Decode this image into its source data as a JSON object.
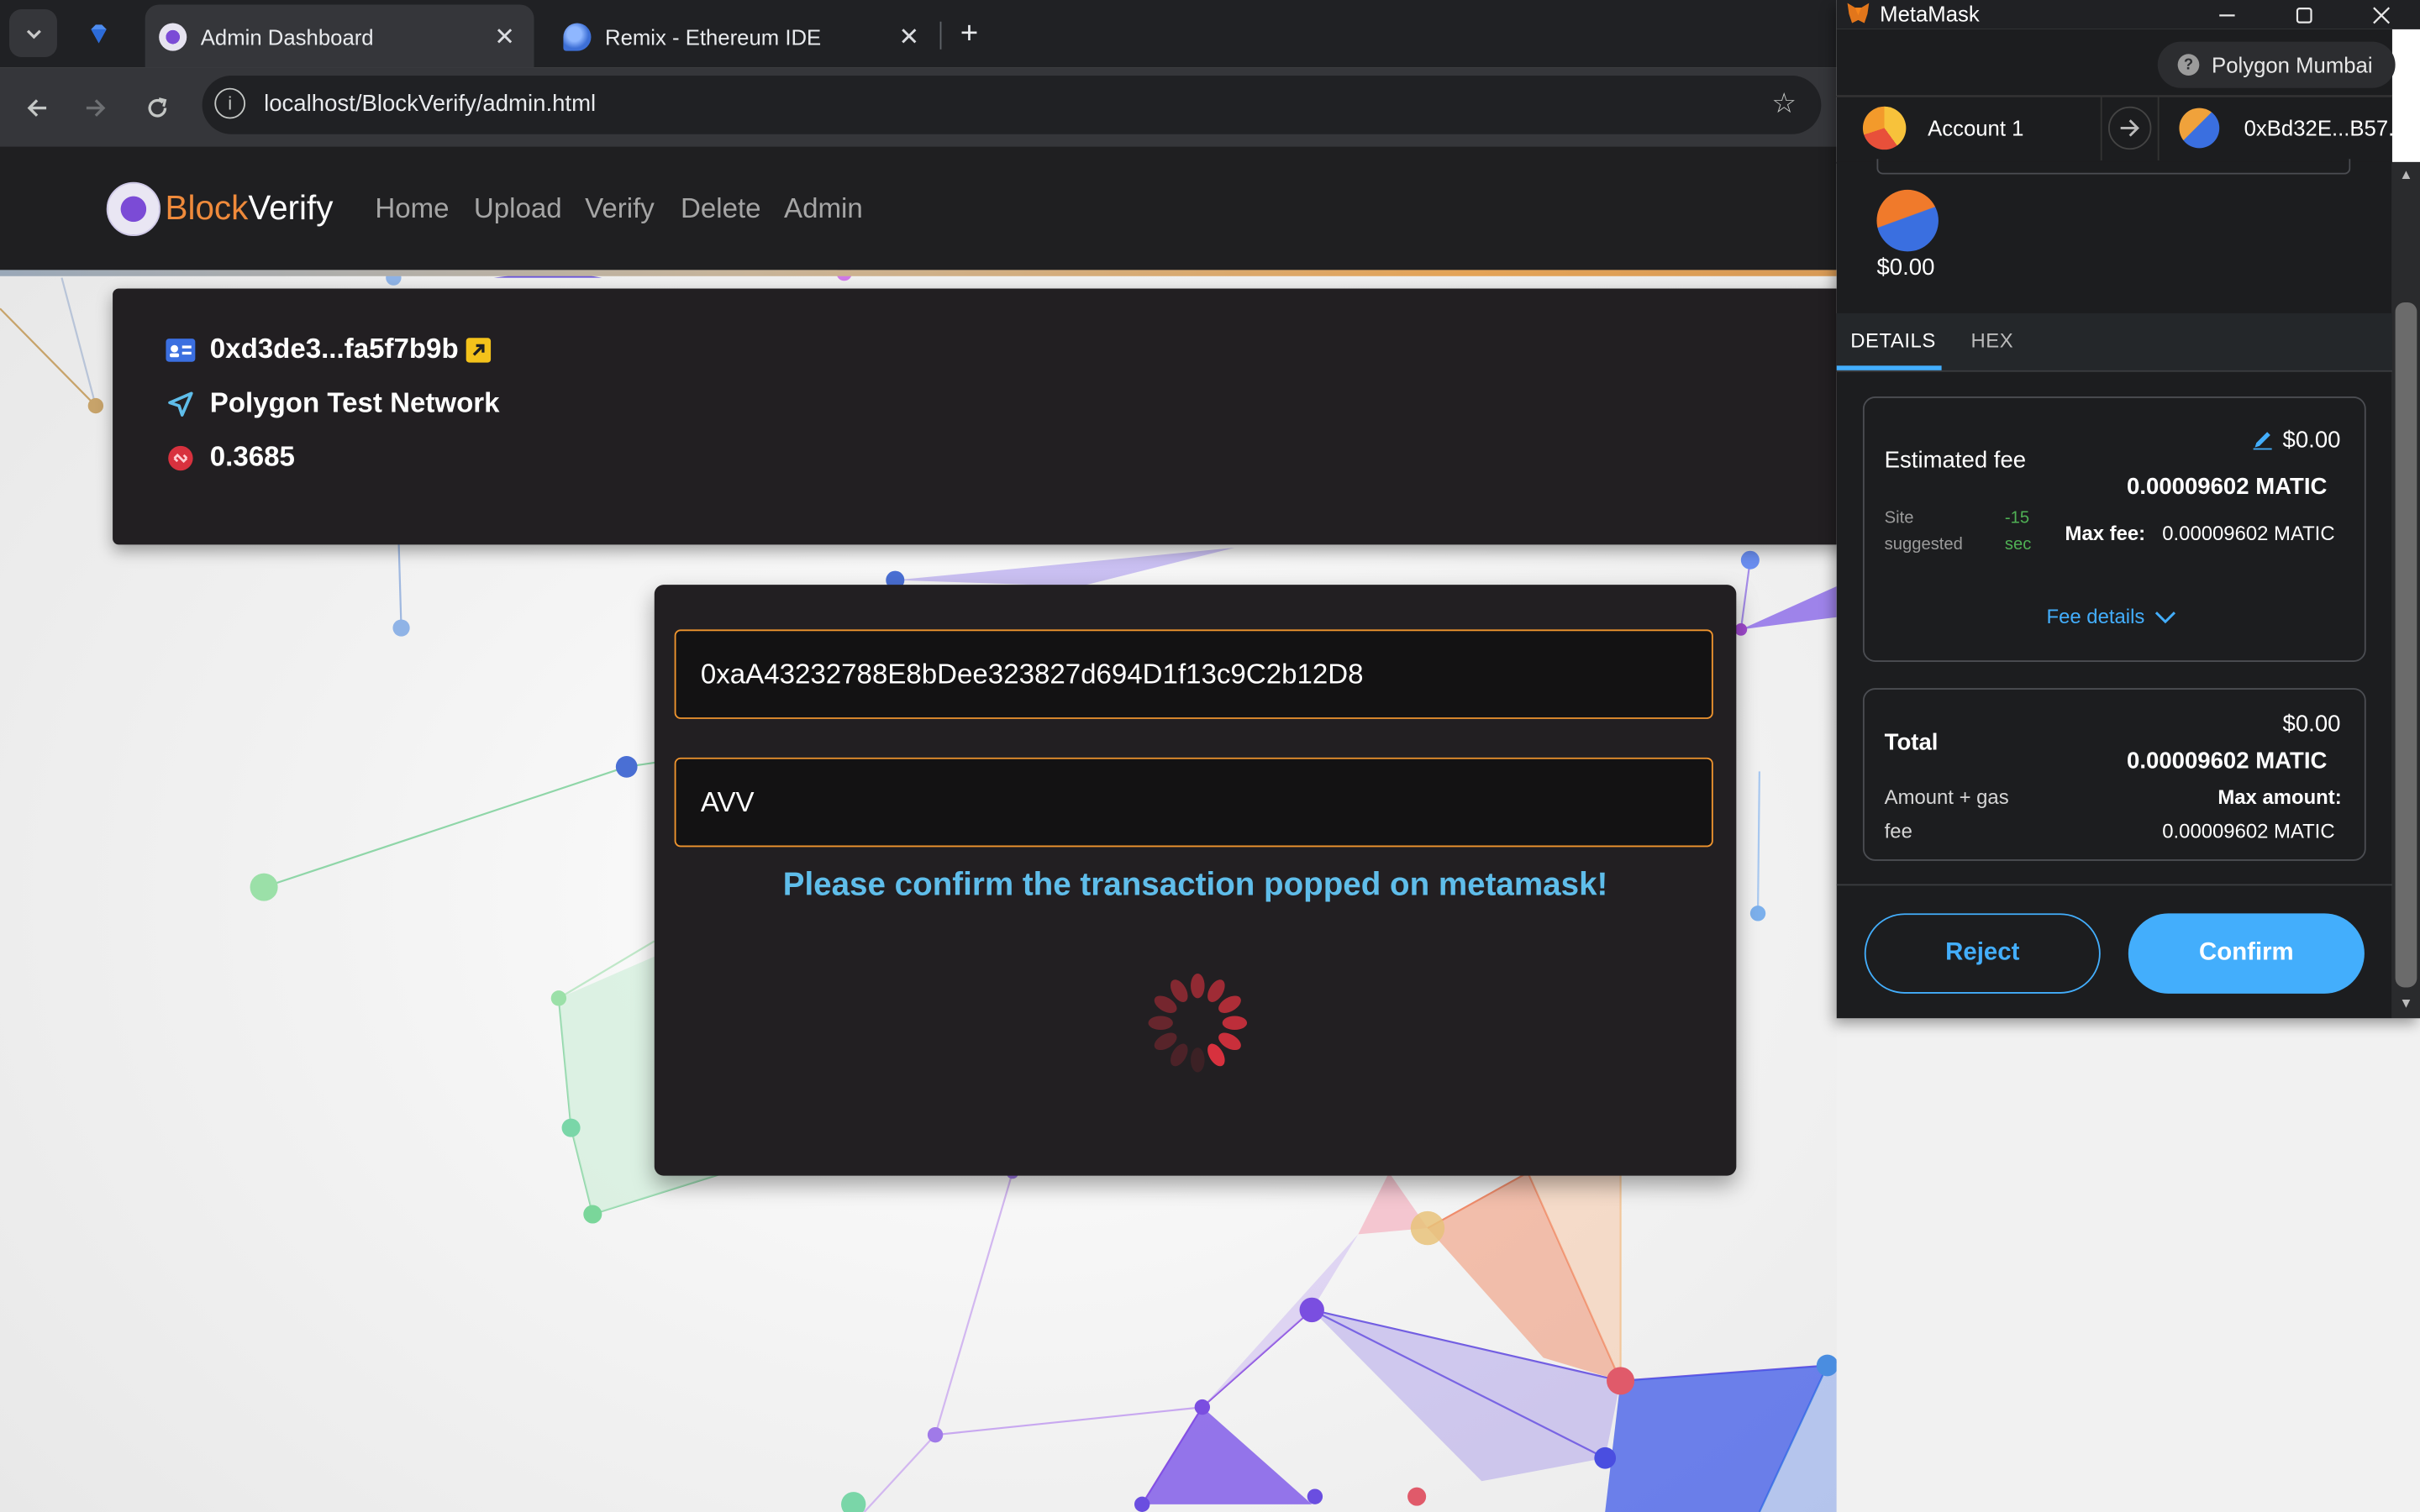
{
  "browser": {
    "tabs": [
      {
        "title": "Admin Dashboard",
        "active": true
      },
      {
        "title": "Remix - Ethereum IDE",
        "active": false
      }
    ],
    "url": "localhost/BlockVerify/admin.html"
  },
  "site": {
    "brand_part1": "Block",
    "brand_part2": "Verify",
    "nav": [
      "Home",
      "Upload",
      "Verify",
      "Delete",
      "Admin"
    ],
    "account": {
      "address": "0xd3de3...fa5f7b9b",
      "network": "Polygon Test Network",
      "balance": "0.3685"
    },
    "form": {
      "address_value": "0xaA43232788E8bDee323827d694D1f13c9C2b12D8",
      "name_value": "AVV",
      "status": "Please confirm the transaction popped on metamask!"
    }
  },
  "metamask": {
    "window_title": "MetaMask",
    "network": "Polygon Mumbai",
    "from_account": "Account 1",
    "to_account": "0xBd32E...B57...",
    "value_usd": "$0.00",
    "tabs": [
      "DETAILS",
      "HEX"
    ],
    "estimated_fee": {
      "label": "Estimated fee",
      "usd": "$0.00",
      "matic": "0.00009602 MATIC",
      "site_suggested_1": "Site",
      "site_suggested_2": "suggested",
      "time_1": "-15",
      "time_2": "sec",
      "max_fee_label": "Max fee:",
      "max_fee_value": "0.00009602 MATIC",
      "fee_details": "Fee details"
    },
    "total": {
      "label": "Total",
      "usd": "$0.00",
      "matic": "0.00009602 MATIC",
      "amount_gas_1": "Amount + gas",
      "amount_gas_2": "fee",
      "max_amount_label": "Max amount:",
      "max_amount_value": "0.00009602 MATIC"
    },
    "reject_label": "Reject",
    "confirm_label": "Confirm"
  },
  "colors": {
    "brand_orange": "#ef8a3b",
    "field_border": "#f0952f",
    "status_blue": "#5fbdea",
    "metamask_blue": "#43aefc",
    "spinner_red": "#d8313e"
  }
}
